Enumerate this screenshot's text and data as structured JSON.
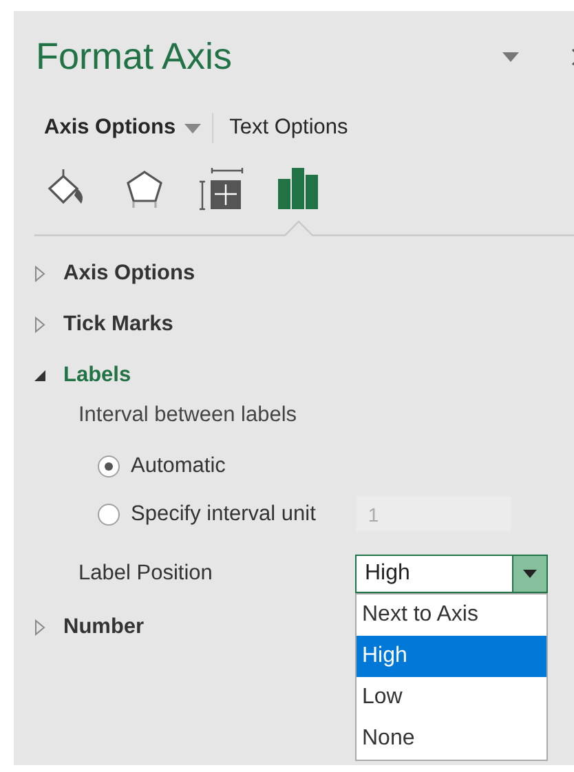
{
  "pane": {
    "title": "Format Axis"
  },
  "option_tabs": [
    {
      "label": "Axis Options",
      "selected": true,
      "has_menu": true
    },
    {
      "label": "Text Options",
      "selected": false,
      "has_menu": false
    }
  ],
  "category_icons": [
    {
      "kind": "fill",
      "selected": false
    },
    {
      "kind": "effects",
      "selected": false
    },
    {
      "kind": "size",
      "selected": false
    },
    {
      "kind": "chart",
      "selected": true
    }
  ],
  "sections": [
    {
      "label": "Axis Options",
      "expanded": false
    },
    {
      "label": "Tick Marks",
      "expanded": false
    },
    {
      "label": "Labels",
      "expanded": true,
      "interval_heading": "Interval between labels",
      "interval_options": [
        {
          "label": "Automatic",
          "selected": true
        },
        {
          "label": "Specify interval unit",
          "selected": false,
          "value": "1",
          "disabled": true
        }
      ],
      "label_position": {
        "label": "Label Position",
        "value": "High",
        "open": true,
        "options": [
          {
            "label": "Next to Axis",
            "selected": false
          },
          {
            "label": "High",
            "selected": true
          },
          {
            "label": "Low",
            "selected": false
          },
          {
            "label": "None",
            "selected": false
          }
        ]
      }
    },
    {
      "label": "Number",
      "expanded": false
    }
  ]
}
